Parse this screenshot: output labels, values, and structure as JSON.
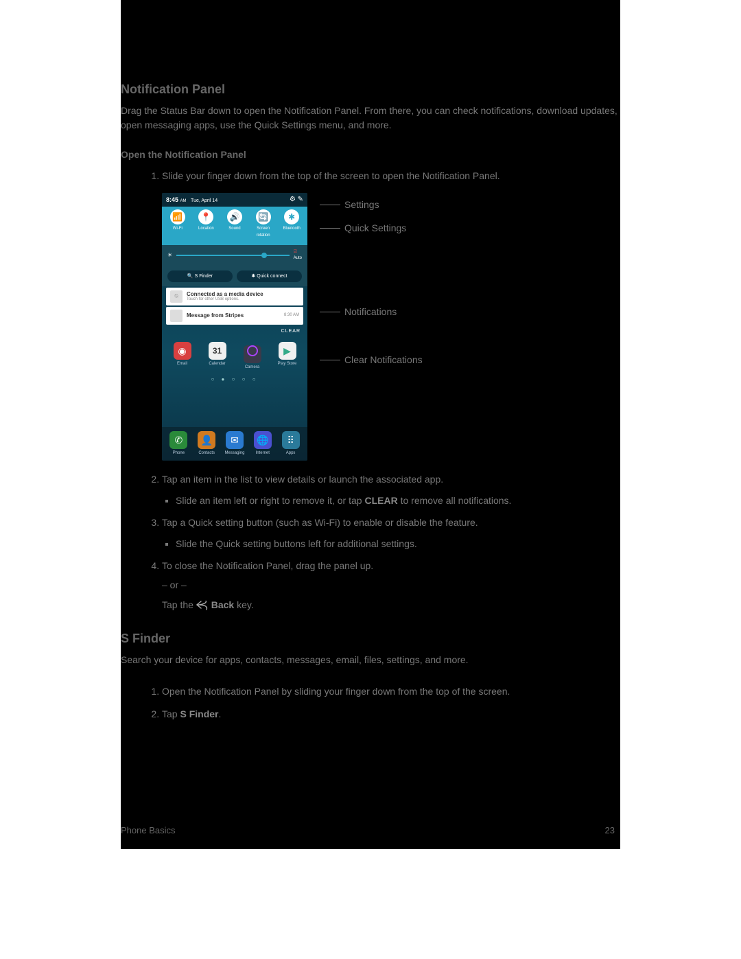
{
  "section1_title": "Notification Panel",
  "intro": "Drag the Status Bar down to open the Notification Panel. From there, you can check notifications, download updates, open messaging apps, use the Quick Settings menu, and more.",
  "subhead_open": "Open the Notification Panel",
  "steps": {
    "s1": "Slide your finger down from the top of the screen to open the Notification Panel.",
    "s2_a": "Tap an item in the list to view details or launch the associated app.",
    "s2_sub_a_pre": "Slide an item left or right to remove it, or tap ",
    "s2_sub_a_bold": "CLEAR",
    "s2_sub_a_post": " to remove all notifications.",
    "s3_a": "Tap a Quick setting button (such as Wi-Fi) to enable or disable the feature.",
    "s3_sub": "Slide the Quick setting buttons left for additional settings.",
    "s4_a": "To close the Notification Panel, drag the panel up.",
    "s4_or": "– or –",
    "s4_tap_pre": "Tap the ",
    "s4_back": "Back",
    "s4_tap_post": " key."
  },
  "section2_title": "S Finder",
  "section2_intro": "Search your device for apps, contacts, messages, email, files, settings, and more.",
  "sf_steps": {
    "s1": "Open the Notification Panel by sliding your finger down from the top of the screen.",
    "s2_pre": "Tap ",
    "s2_bold": "S Finder",
    "s2_post": "."
  },
  "footer_left": "Phone Basics",
  "footer_right": "23",
  "phone": {
    "time": "8:45",
    "ampm": "AM",
    "date": "Tue, April 14",
    "qs": [
      {
        "icon": "📶",
        "label": "Wi-Fi"
      },
      {
        "icon": "📍",
        "label": "Location"
      },
      {
        "icon": "🔊",
        "label": "Sound"
      },
      {
        "icon": "🔄",
        "label": "Screen rotation"
      },
      {
        "icon": "✱",
        "label": "Bluetooth"
      }
    ],
    "auto": "Auto",
    "sfinder": "S Finder",
    "qconnect": "Quick connect",
    "notif1_title": "Connected as a media device",
    "notif1_sub": "Touch for other USB options.",
    "notif2_title": "Message from Stripes",
    "notif2_time": "8:30 AM",
    "clear": "CLEAR",
    "apps1": [
      {
        "label": "Email",
        "bg": "#d94040"
      },
      {
        "label": "Calendar",
        "bg": "#f0f0f0"
      },
      {
        "label": "Camera",
        "bg": "#3a3a4a"
      },
      {
        "label": "Play Store",
        "bg": "#f0f0f0"
      }
    ],
    "dock": [
      {
        "label": "Phone",
        "bg": "#2a8a3a"
      },
      {
        "label": "Contacts",
        "bg": "#d07a20"
      },
      {
        "label": "Messaging",
        "bg": "#2a7ad0"
      },
      {
        "label": "Internet",
        "bg": "#4a50d0"
      },
      {
        "label": "Apps",
        "bg": "#2a7a9a"
      }
    ],
    "cal_num": "31"
  },
  "callouts": {
    "settings": "Settings",
    "quick": "Quick Settings",
    "notifications": "Notifications",
    "clear": "Clear Notifications"
  }
}
